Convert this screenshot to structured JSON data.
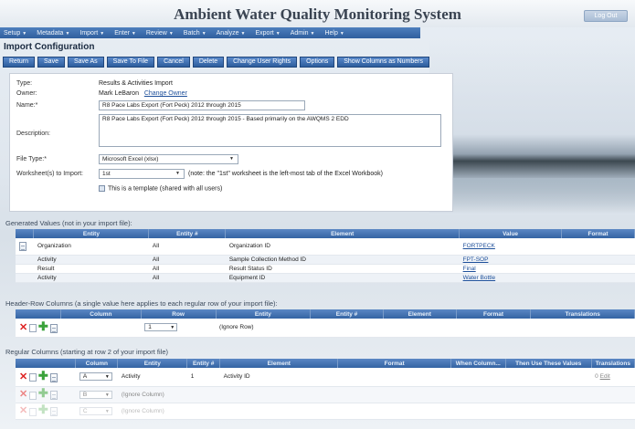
{
  "app": {
    "title": "Ambient Water Quality Monitoring System",
    "logout_label": "Log Out"
  },
  "menu": [
    {
      "label": "Setup"
    },
    {
      "label": "Metadata"
    },
    {
      "label": "Import"
    },
    {
      "label": "Enter"
    },
    {
      "label": "Review"
    },
    {
      "label": "Batch"
    },
    {
      "label": "Analyze"
    },
    {
      "label": "Export"
    },
    {
      "label": "Admin"
    },
    {
      "label": "Help"
    }
  ],
  "page_title": "Import Configuration",
  "toolbar": [
    "Return",
    "Save",
    "Save As",
    "Save To File",
    "Cancel",
    "Delete",
    "Change User Rights",
    "Options",
    "Show Columns as Numbers"
  ],
  "form": {
    "type_label": "Type:",
    "type_value": "Results & Activities Import",
    "owner_label": "Owner:",
    "owner_value": "Mark LeBaron",
    "change_owner": "Change Owner",
    "name_label": "Name:*",
    "name_value": "R8 Pace Labs Export (Fort Peck) 2012 through 2015",
    "description_label": "Description:",
    "description_value": "R8 Pace Labs Export (Fort Peck) 2012 through 2015 - Based primarily on the AWQMS 2 EDD",
    "file_type_label": "File Type:*",
    "file_type_value": "Microsoft Excel (xlsx)",
    "worksheet_label": "Worksheet(s) to Import:",
    "worksheet_value": "1st",
    "worksheet_note": "(note: the \"1st\" worksheet is the left-most tab of the Excel Workbook)",
    "template_label": "This is a template (shared with all users)"
  },
  "generated": {
    "title": "Generated Values (not in your import file):",
    "columns": [
      "Entity",
      "Entity #",
      "Element",
      "Value",
      "Format"
    ],
    "rows": [
      {
        "entity": "Organization",
        "num": "All",
        "element": "Organization ID",
        "value": "FORTPECK"
      },
      {
        "entity": "Activity",
        "num": "All",
        "element": "Sample Collection Method ID",
        "value": "FPT-SOP"
      },
      {
        "entity": "Result",
        "num": "All",
        "element": "Result Status ID",
        "value": "Final"
      },
      {
        "entity": "Activity",
        "num": "All",
        "element": "Equipment ID",
        "value": "Water Bottle"
      }
    ]
  },
  "header_row": {
    "title": "Header-Row Columns (a single value here applies to each regular row of your import file):",
    "columns": [
      "Column",
      "Row",
      "Entity",
      "Entity #",
      "Element",
      "Format",
      "Translations"
    ],
    "row": {
      "row_value": "1",
      "entity": "(Ignore Row)"
    }
  },
  "regular": {
    "title": "Regular Columns (starting at row 2 of your import file)",
    "columns": [
      "Column",
      "Entity",
      "Entity #",
      "Element",
      "Format",
      "When Column...",
      "Then Use These Values",
      "Translations"
    ],
    "rows": [
      {
        "col": "A",
        "entity": "Activity",
        "num": "1",
        "element": "Activity ID",
        "trans_count": "0",
        "edit": "Edit"
      },
      {
        "col": "B",
        "entity": "(Ignore Column)"
      },
      {
        "col": "C",
        "entity": "(Ignore Column)"
      }
    ]
  }
}
